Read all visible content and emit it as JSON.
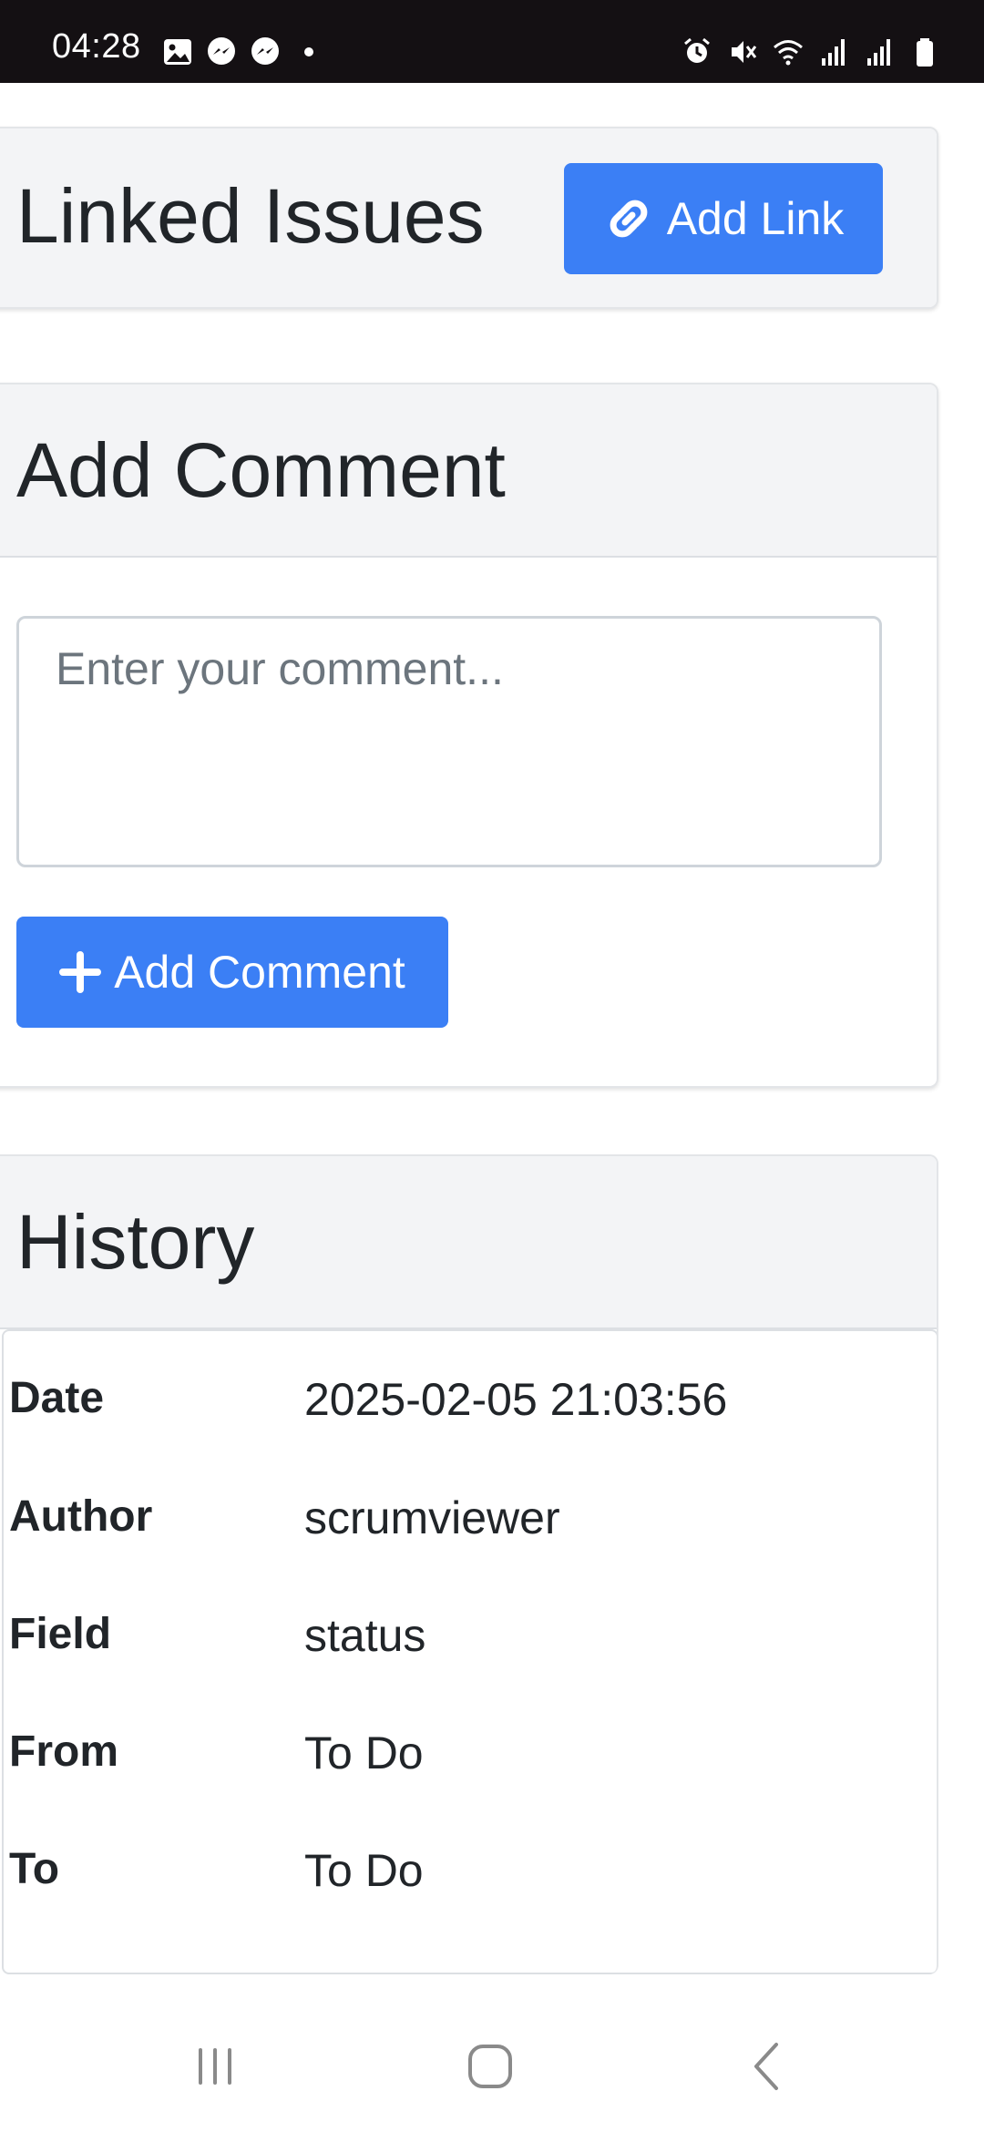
{
  "status_bar": {
    "time": "04:28",
    "left_icons": [
      "gallery-icon",
      "messenger-icon",
      "messenger-icon",
      "dot-icon"
    ],
    "right_icons": [
      "alarm-icon",
      "mute-icon",
      "wifi-icon",
      "signal-icon",
      "signal-icon",
      "battery-icon"
    ]
  },
  "linked_issues": {
    "title": "Linked Issues",
    "add_link_label": "Add Link",
    "add_link_icon": "link-icon"
  },
  "add_comment": {
    "title": "Add Comment",
    "placeholder": "Enter your comment...",
    "button_label": "Add Comment",
    "button_icon": "plus-icon"
  },
  "history": {
    "title": "History",
    "rows": [
      {
        "label": "Date",
        "value": "2025-02-05 21:03:56"
      },
      {
        "label": "Author",
        "value": "scrumviewer"
      },
      {
        "label": "Field",
        "value": "status"
      },
      {
        "label": "From",
        "value": "To Do"
      },
      {
        "label": "To",
        "value": "To Do"
      }
    ]
  },
  "nav_bar": {
    "items": [
      "recent-apps-icon",
      "home-icon",
      "back-icon"
    ]
  },
  "colors": {
    "primary": "#3b7ff5",
    "status_bar": "#141013",
    "card_header": "#f3f4f6"
  }
}
